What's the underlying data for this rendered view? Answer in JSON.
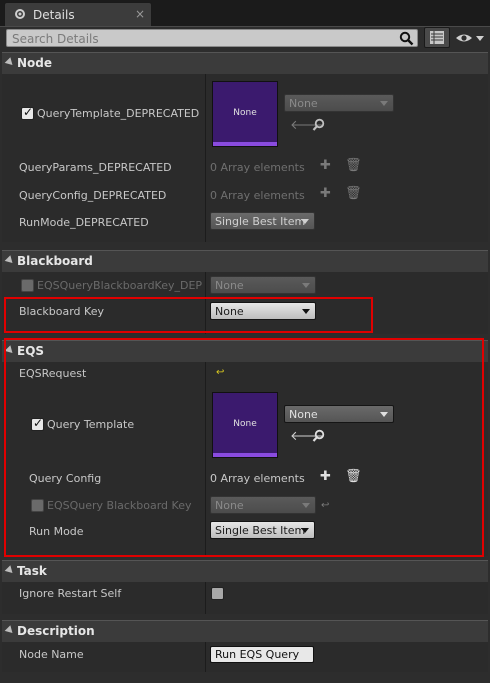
{
  "tab": {
    "title": "Details",
    "close": "×"
  },
  "search": {
    "placeholder": "Search Details"
  },
  "node": {
    "header": "Node",
    "query_template": {
      "label": "QueryTemplate_DEPRECATED",
      "checked": true,
      "thumb": "None",
      "combo": "None"
    },
    "query_params": {
      "label": "QueryParams_DEPRECATED",
      "value": "0 Array elements"
    },
    "query_config": {
      "label": "QueryConfig_DEPRECATED",
      "value": "0 Array elements"
    },
    "run_mode": {
      "label": "RunMode_DEPRECATED",
      "value": "Single Best Item"
    }
  },
  "blackboard": {
    "header": "Blackboard",
    "eqs_key": {
      "label": "EQSQueryBlackboardKey_DEPRE",
      "value": "None"
    },
    "bb_key": {
      "label": "Blackboard Key",
      "value": "None"
    }
  },
  "eqs": {
    "header": "EQS",
    "request": {
      "label": "EQSRequest"
    },
    "query_template": {
      "label": "Query Template",
      "checked": true,
      "thumb": "None",
      "combo": "None"
    },
    "query_config": {
      "label": "Query Config",
      "value": "0 Array elements"
    },
    "bb_key": {
      "label": "EQSQuery Blackboard Key",
      "value": "None"
    },
    "run_mode": {
      "label": "Run Mode",
      "value": "Single Best Item"
    }
  },
  "task": {
    "header": "Task",
    "ignore_restart": {
      "label": "Ignore Restart Self",
      "checked": false
    }
  },
  "description": {
    "header": "Description",
    "node_name": {
      "label": "Node Name",
      "value": "Run EQS Query"
    }
  },
  "colors": {
    "highlight": "#e00000",
    "thumb": "#3b1a6e",
    "thumb_bar": "#8a4be0"
  }
}
